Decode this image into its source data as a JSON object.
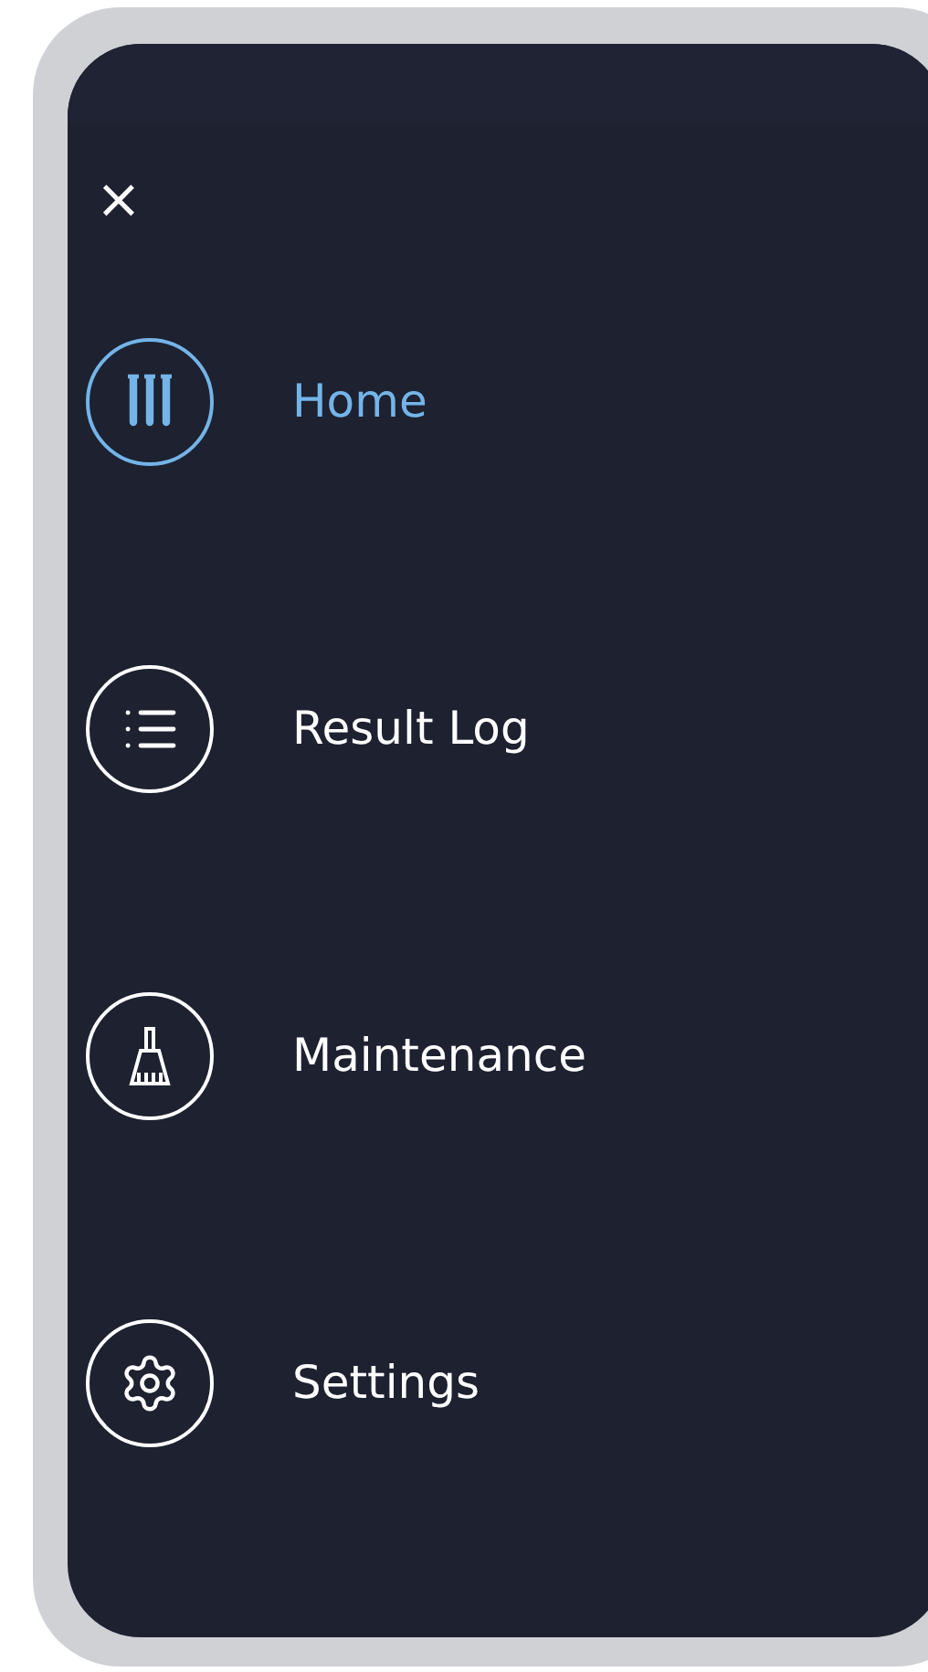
{
  "close_button": {
    "label": "×"
  },
  "menu": [
    {
      "kind": "tubes",
      "label": "Home",
      "selected": true
    },
    {
      "kind": "list",
      "label": "Result Log",
      "selected": false
    },
    {
      "kind": "broom",
      "label": "Maintenance",
      "selected": false
    },
    {
      "kind": "gear",
      "label": "Settings",
      "selected": false
    }
  ]
}
